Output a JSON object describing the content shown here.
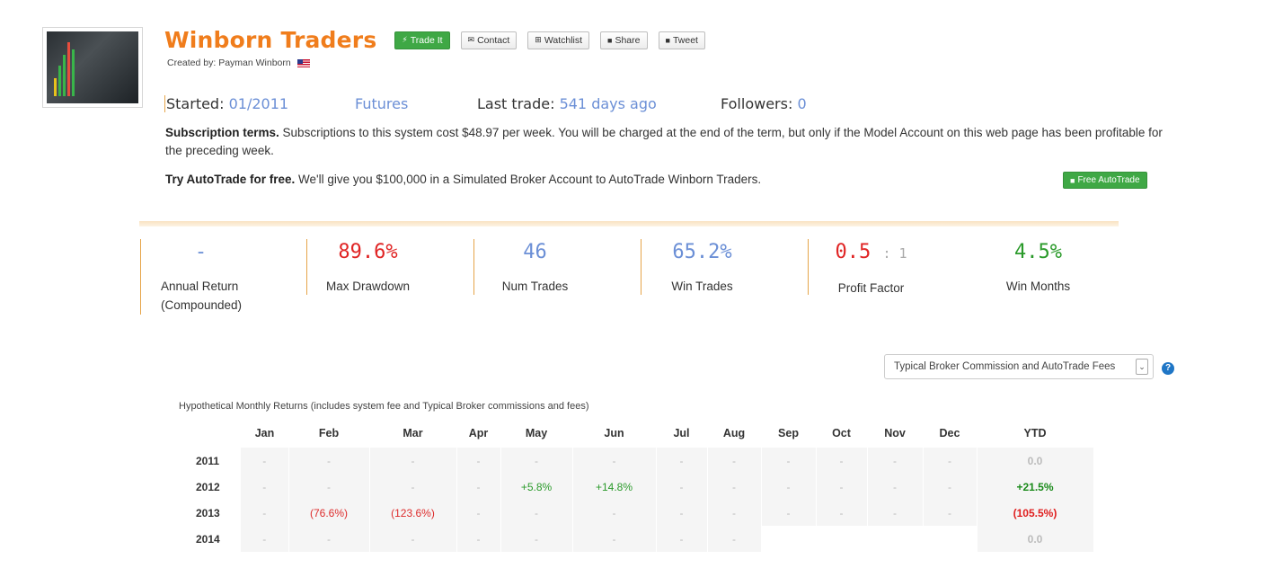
{
  "system": {
    "title": "Winborn Traders",
    "created_by": "Created by: Payman Winborn",
    "buttons": {
      "trade_it": "Trade It",
      "contact": "Contact",
      "watchlist": "Watchlist",
      "share": "Share",
      "tweet": "Tweet"
    }
  },
  "stats": {
    "started_label": "Started:",
    "started_value": "01/2011",
    "category": "Futures",
    "last_trade_label": "Last trade:",
    "last_trade_value": "541 days ago",
    "followers_label": "Followers:",
    "followers_value": "0"
  },
  "terms": {
    "heading": "Subscription terms.",
    "text": "Subscriptions to this system cost $48.97 per week. You will be charged at the end of the term, but only if the Model Account on this web page has been profitable for the preceding week."
  },
  "autotrade": {
    "heading": "Try AutoTrade for free.",
    "text": "We'll give you $100,000 in a Simulated Broker Account to AutoTrade Winborn Traders.",
    "button": "Free AutoTrade"
  },
  "metrics": [
    {
      "value": "-",
      "label": "Annual Return (Compounded)",
      "color": "#6b8fd6"
    },
    {
      "value": "89.6%",
      "label": "Max Drawdown",
      "color": "#e02424"
    },
    {
      "value": "46",
      "label": "Num Trades",
      "color": "#6b8fd6"
    },
    {
      "value": "65.2%",
      "label": "Win Trades",
      "color": "#6b8fd6"
    },
    {
      "value": "0.5",
      "value_suffix": ": 1",
      "label": "Profit Factor",
      "color": "#e02424"
    },
    {
      "value": "4.5%",
      "label": "Win Months",
      "color": "#2a9a2a"
    }
  ],
  "fee_select": {
    "selected": "Typical Broker Commission and AutoTrade Fees"
  },
  "returns_table": {
    "caption": "Hypothetical Monthly Returns (includes system fee and Typical Broker commissions and fees)",
    "headers": [
      "",
      "Jan",
      "Feb",
      "Mar",
      "Apr",
      "May",
      "Jun",
      "Jul",
      "Aug",
      "Sep",
      "Oct",
      "Nov",
      "Dec",
      "YTD"
    ],
    "rows": [
      {
        "year": "2011",
        "months": [
          "-",
          "-",
          "-",
          "-",
          "-",
          "-",
          "-",
          "-",
          "-",
          "-",
          "-",
          "-"
        ],
        "ytd": "0.0"
      },
      {
        "year": "2012",
        "months": [
          "-",
          "-",
          "-",
          "-",
          "+5.8%",
          "+14.8%",
          "-",
          "-",
          "-",
          "-",
          "-",
          "-"
        ],
        "ytd": "+21.5%"
      },
      {
        "year": "2013",
        "months": [
          "-",
          "(76.6%)",
          "(123.6%)",
          "-",
          "-",
          "-",
          "-",
          "-",
          "-",
          "-",
          "-",
          "-"
        ],
        "ytd": "(105.5%)"
      },
      {
        "year": "2014",
        "months": [
          "-",
          "-",
          "-",
          "-",
          "-",
          "-",
          "-",
          "-",
          "",
          "",
          "",
          ""
        ],
        "ytd": "0.0"
      }
    ]
  }
}
